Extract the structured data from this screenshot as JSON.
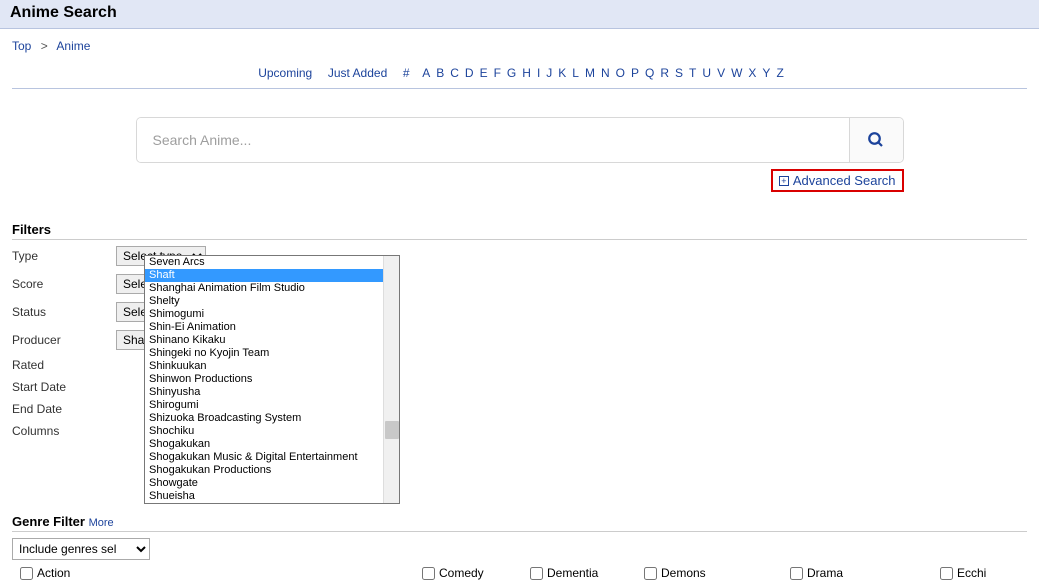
{
  "page_title": "Anime Search",
  "breadcrumb": {
    "top": "Top",
    "anime": "Anime"
  },
  "alpha_nav": {
    "upcoming": "Upcoming",
    "just_added": "Just Added",
    "hash": "#",
    "letters": [
      "A",
      "B",
      "C",
      "D",
      "E",
      "F",
      "G",
      "H",
      "I",
      "J",
      "K",
      "L",
      "M",
      "N",
      "O",
      "P",
      "Q",
      "R",
      "S",
      "T",
      "U",
      "V",
      "W",
      "X",
      "Y",
      "Z"
    ]
  },
  "search": {
    "placeholder": "Search Anime..."
  },
  "advanced_label": "Advanced Search",
  "filters_header": "Filters",
  "filters": {
    "type": {
      "label": "Type",
      "value": "Select type"
    },
    "score": {
      "label": "Score",
      "value": "Select score"
    },
    "status": {
      "label": "Status",
      "value": "Select status"
    },
    "producer": {
      "label": "Producer",
      "value": "Shaft"
    },
    "rated": {
      "label": "Rated"
    },
    "start_date": {
      "label": "Start Date"
    },
    "end_date": {
      "label": "End Date"
    },
    "columns": {
      "label": "Columns"
    }
  },
  "producer_options": [
    "Seven Arcs",
    "Shaft",
    "Shanghai Animation Film Studio",
    "Shelty",
    "Shimogumi",
    "Shin-Ei Animation",
    "Shinano Kikaku",
    "Shingeki no Kyojin Team",
    "Shinkuukan",
    "Shinwon Productions",
    "Shinyusha",
    "Shirogumi",
    "Shizuoka Broadcasting System",
    "Shochiku",
    "Shogakukan",
    "Shogakukan Music & Digital Entertainment",
    "Shogakukan Productions",
    "Showgate",
    "Shueisha"
  ],
  "producer_selected_index": 1,
  "genre_header": "Genre Filter",
  "genre_more": "More",
  "genre_include_value": "Include genres sel",
  "genres": {
    "action": "Action",
    "comedy": "Comedy",
    "dementia": "Dementia",
    "demons": "Demons",
    "drama": "Drama",
    "ecchi": "Ecchi"
  }
}
